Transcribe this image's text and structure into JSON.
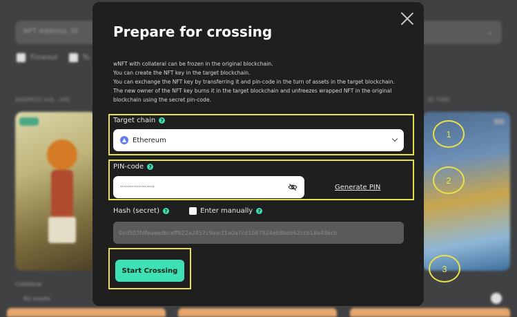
{
  "background": {
    "search_text": "NFT Address, ID",
    "filters": [
      "Timeout",
      "To"
    ],
    "left_meta": "ADDRESS 0x6...285",
    "right_meta": "ID 7085",
    "left_sublabel": "Collateral",
    "left_sublabel2": "No assets"
  },
  "modal": {
    "title": "Prepare for crossing",
    "description": [
      "wNFT with collateral can be frozen in the original blockchain.",
      "You can create the NFT key in the target blockchain.",
      "You can exchange the NFT key by transferring it and pin-code in the turn of assets in the target blockchain.",
      "The new owner of the NFT key burns it in the target blockchain and unfreezes wrapped NFT in the original blockchain using the secret pin-code."
    ],
    "target_chain_label": "Target chain",
    "target_chain_value": "Ethereum",
    "pin_label": "PIN-code",
    "pin_value": "·····················",
    "generate_pin": "Generate PIN",
    "hash_label": "Hash (secret)",
    "enter_manually": "Enter manually",
    "hash_value": "0xd503fdfeaeedbceff822a2457c9aacf1a0a7cd1b87824eb8beb62ccb18a486cb",
    "start_button": "Start Crossing"
  },
  "annotations": [
    "1",
    "2",
    "3"
  ],
  "colors": {
    "accent": "#3ee0b4",
    "highlight": "#e8e14a",
    "modal_bg": "#1f1f20",
    "ethereum": "#627eea"
  }
}
